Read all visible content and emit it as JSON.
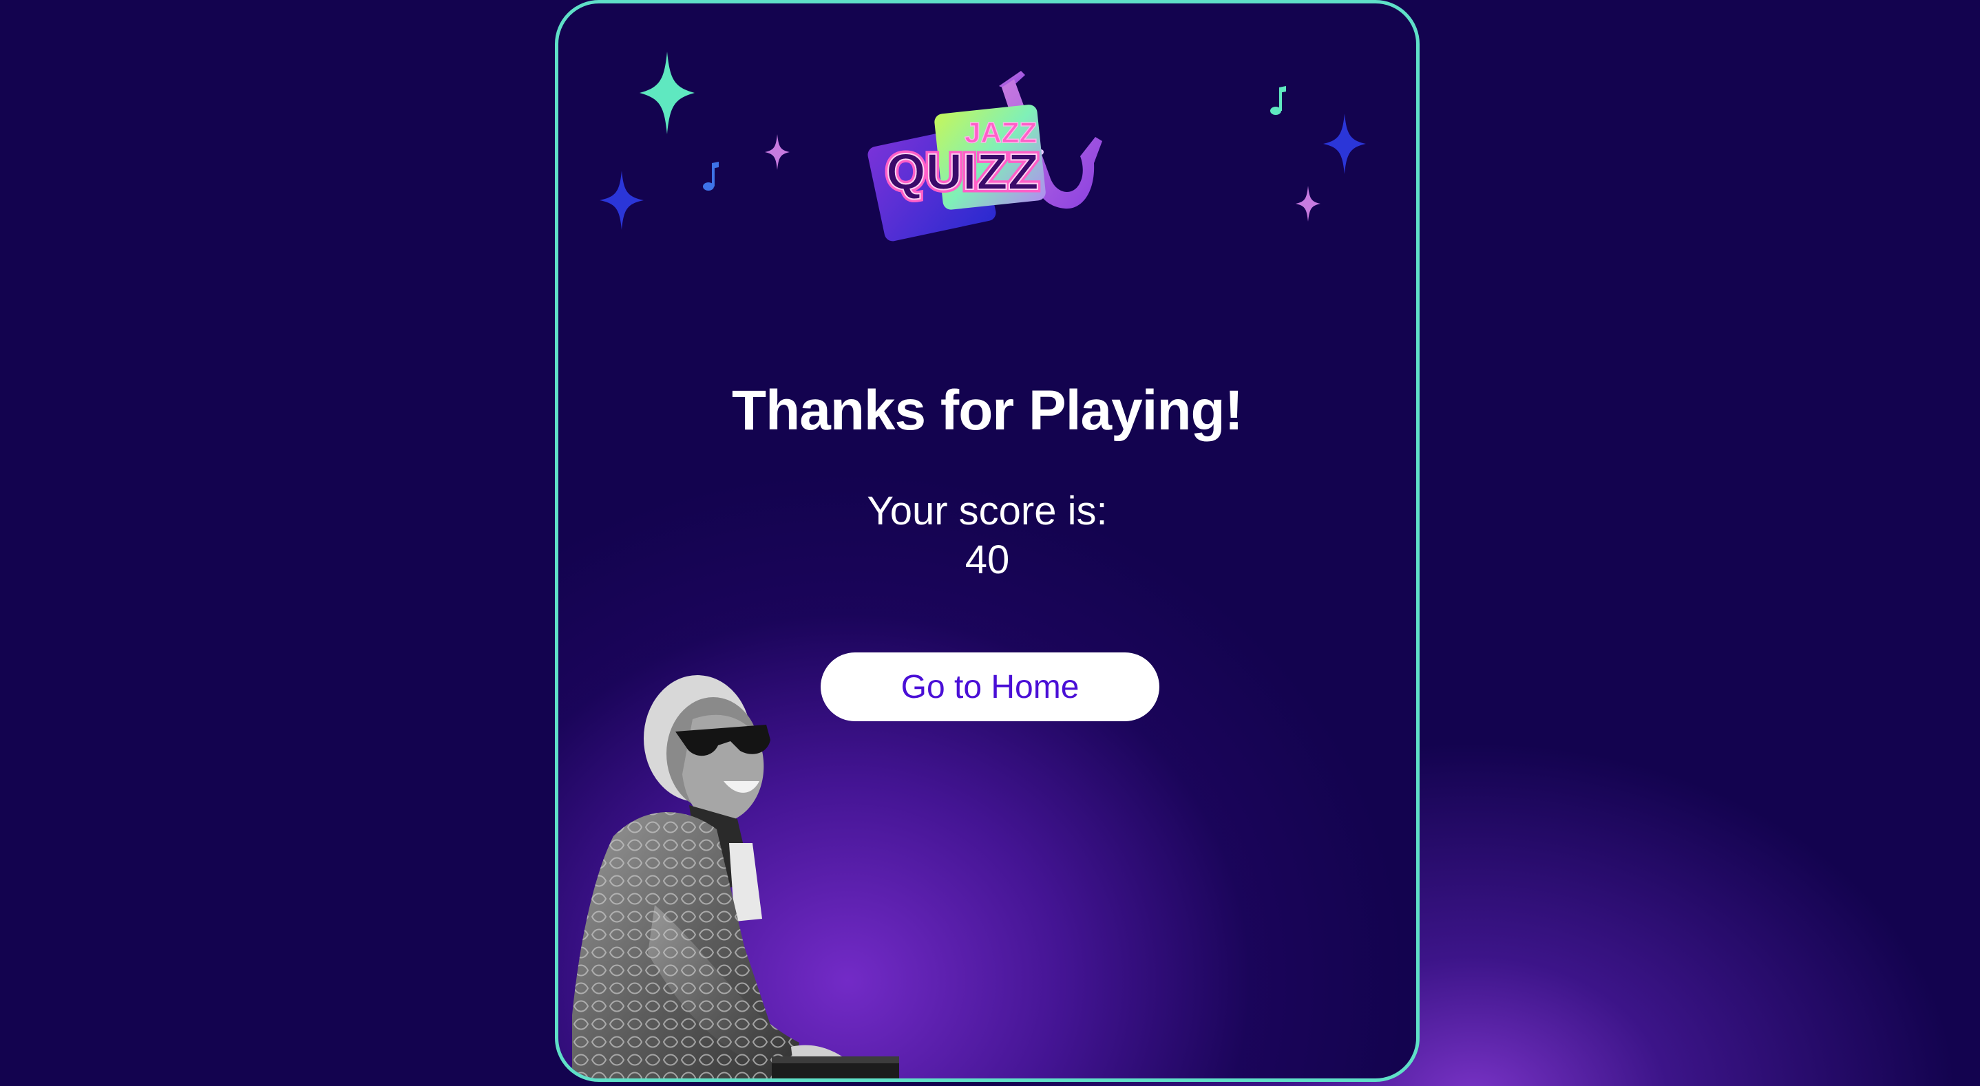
{
  "app": {
    "logo_text_top": "JAZZ",
    "logo_text_main": "QUIZZ"
  },
  "result": {
    "title": "Thanks for Playing!",
    "score_label": "Your score is:",
    "score_value": "40"
  },
  "actions": {
    "home_label": "Go to Home"
  },
  "colors": {
    "background": "#13034f",
    "card_border": "#5fe0c8",
    "accent_purple": "#7a2fd0",
    "button_text": "#4a0fd6",
    "sparkle_teal": "#5fe8c0",
    "sparkle_blue": "#2b36d8",
    "sparkle_pink": "#c77be0"
  },
  "icons": [
    "sparkle-icon",
    "music-note-icon",
    "saxophone-icon"
  ]
}
